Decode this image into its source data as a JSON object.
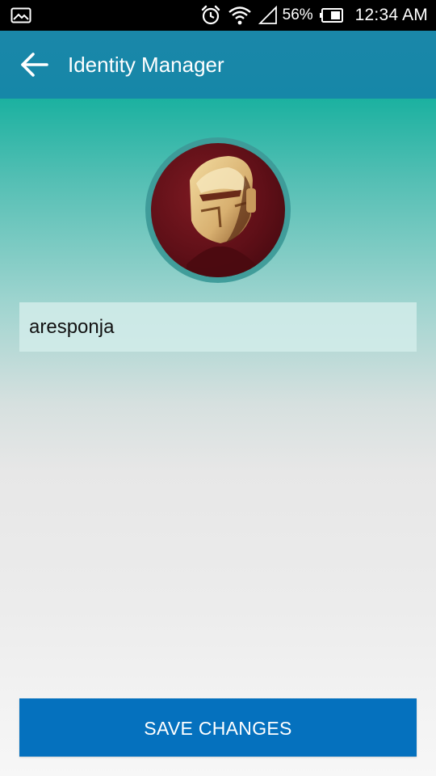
{
  "status_bar": {
    "notification_icon": "gallery-icon",
    "icons": [
      "alarm-icon",
      "wifi-icon",
      "signal-icon",
      "battery-icon"
    ],
    "battery_percent": "56%",
    "time": "12:34 AM"
  },
  "app_bar": {
    "back_icon": "arrow-left-icon",
    "title": "Identity Manager",
    "color": "#1a87a9"
  },
  "profile": {
    "avatar": "avatar-image",
    "username_value": "aresponja"
  },
  "actions": {
    "save_label": "SAVE CHANGES",
    "save_color": "#0571be"
  },
  "theme": {
    "gradient_top": "#1bb1a0",
    "gradient_bottom": "#f7f7f7"
  }
}
